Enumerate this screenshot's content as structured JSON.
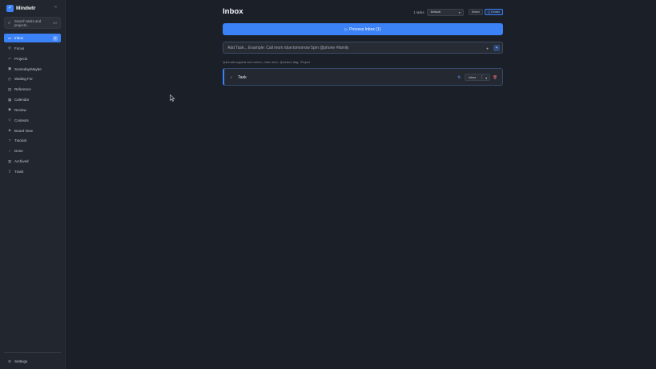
{
  "app": {
    "name": "Mindwtr",
    "logo": "check-square-icon"
  },
  "sidebar": {
    "search_label": "Search tasks and projects...",
    "search_shortcut": "⌘K",
    "items": [
      {
        "label": "Inbox",
        "icon": "inbox-icon",
        "glyph": "▭",
        "count": "1",
        "active": true
      },
      {
        "label": "Focus",
        "icon": "target-icon",
        "glyph": "◎"
      },
      {
        "label": "Projects",
        "icon": "folder-icon",
        "glyph": "▱"
      },
      {
        "label": "Someday/Maybe",
        "icon": "archive-box-icon",
        "glyph": "▣"
      },
      {
        "label": "Waiting For",
        "icon": "clock-icon",
        "glyph": "◷"
      },
      {
        "label": "Reference",
        "icon": "book-icon",
        "glyph": "▤"
      },
      {
        "label": "Calendar",
        "icon": "calendar-icon",
        "glyph": "▦"
      },
      {
        "label": "Review",
        "icon": "check-circle-icon",
        "glyph": "◉"
      },
      {
        "label": "Contexts",
        "icon": "tag-icon",
        "glyph": "◇"
      },
      {
        "label": "Board View",
        "icon": "layers-icon",
        "glyph": "◈"
      },
      {
        "label": "Tutorial",
        "icon": "help-icon",
        "glyph": "?"
      },
      {
        "label": "Done",
        "icon": "done-circle-icon",
        "glyph": "○"
      },
      {
        "label": "Archived",
        "icon": "archive-icon",
        "glyph": "▥"
      },
      {
        "label": "Trash",
        "icon": "trash-icon",
        "glyph": "▯"
      }
    ],
    "settings_label": "Settings",
    "settings_icon": "gear-icon"
  },
  "main": {
    "title": "Inbox",
    "task_count": "1 tasks",
    "sort_value": "Default",
    "select_label": "Select",
    "details_label": "◫ Details",
    "process_label": "Process Inbox (1)",
    "add_task_placeholder": "Add Task... Example: Call mom /due:tomorrow 5pm @phone #family",
    "hint": "Quick add supports /due:<when>, /note:<text>, @context, #tag, +Project",
    "tasks": [
      {
        "title": "Task",
        "status": "Inbox"
      }
    ]
  },
  "colors": {
    "accent": "#3b82f6",
    "background": "#1b1f27",
    "sidebar": "#22262e",
    "danger": "#e06c75"
  }
}
